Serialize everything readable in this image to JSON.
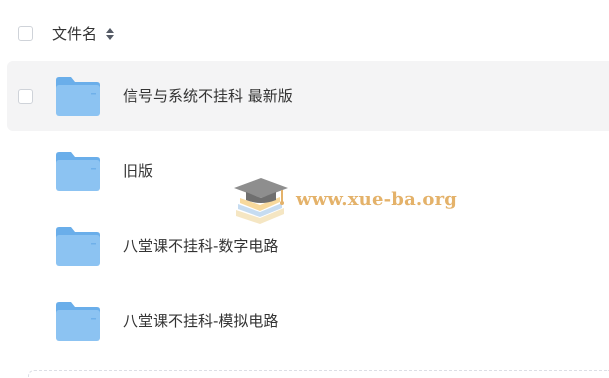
{
  "header": {
    "name_column_label": "文件名",
    "sort_icon": "sort-icon"
  },
  "files": [
    {
      "name": "信号与系统不挂科 最新版",
      "icon": "folder-icon",
      "selected": true
    },
    {
      "name": "旧版",
      "icon": "folder-icon",
      "selected": false
    },
    {
      "name": "八堂课不挂科-数字电路",
      "icon": "folder-icon",
      "selected": false
    },
    {
      "name": "八堂课不挂科-模拟电路",
      "icon": "folder-icon",
      "selected": false
    }
  ],
  "watermark": {
    "text": "www.xue-ba.org",
    "icon": "graduation-cap-logo"
  },
  "colors": {
    "folder": "#8cc3f2",
    "folder_tab": "#6aaeea",
    "row_hover": "#f4f4f5",
    "watermark_text": "#e4b26a"
  }
}
